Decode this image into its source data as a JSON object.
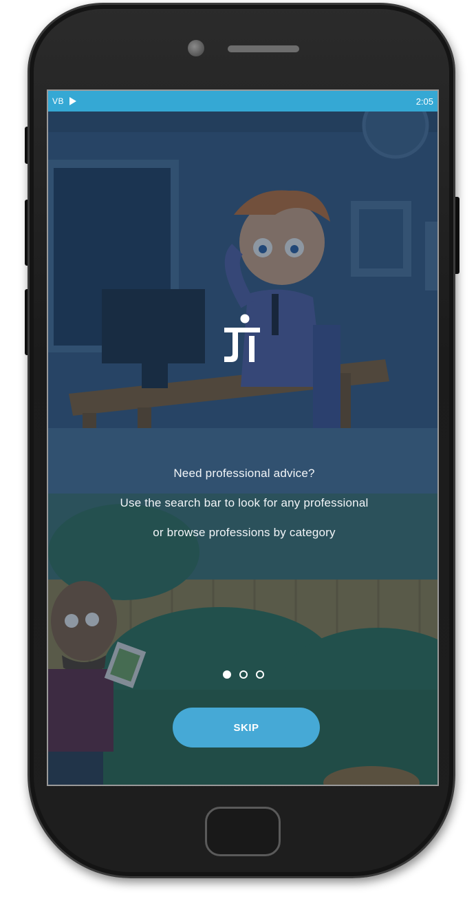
{
  "status_bar": {
    "app_label": "VB",
    "time": "2:05",
    "notification_icon": "play-icon"
  },
  "onboarding": {
    "logo_icon": "jt-logo-icon",
    "lines": [
      "Need professional advice?",
      "Use the search bar to look for any professional",
      "or browse professions by category"
    ],
    "pagination": {
      "total": 3,
      "active": 1
    },
    "skip_label": "SKIP"
  },
  "colors": {
    "status_bar": "#35a8d4",
    "skip_button": "#46a9d6",
    "text": "#f2f5f8"
  }
}
